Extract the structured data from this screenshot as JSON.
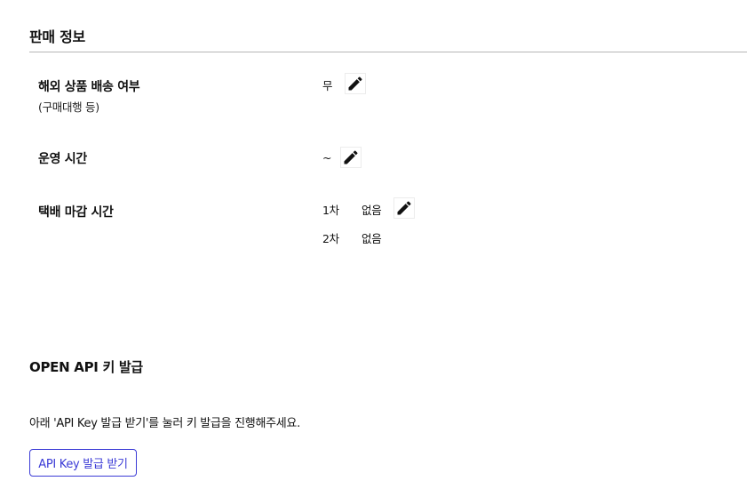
{
  "sales_info": {
    "title": "판매 정보",
    "overseas": {
      "label": "해외 상품 배송 여부",
      "sublabel": "(구매대행 등)",
      "value": "무"
    },
    "hours": {
      "label": "운영 시간",
      "value": "~"
    },
    "cutoff": {
      "label": "택배 마감 시간",
      "rows": [
        {
          "order": "1차",
          "value": "없음"
        },
        {
          "order": "2차",
          "value": "없음"
        }
      ]
    }
  },
  "open_api": {
    "title": "OPEN API 키 발급",
    "notice": "아래 'API Key 발급 받기'를 눌러 키 발급을 진행해주세요.",
    "button_label": "API Key 발급 받기"
  },
  "icons": {
    "edit": "pencil-icon"
  },
  "colors": {
    "accent": "#3b3bd6",
    "divider": "#b5b5b5"
  }
}
